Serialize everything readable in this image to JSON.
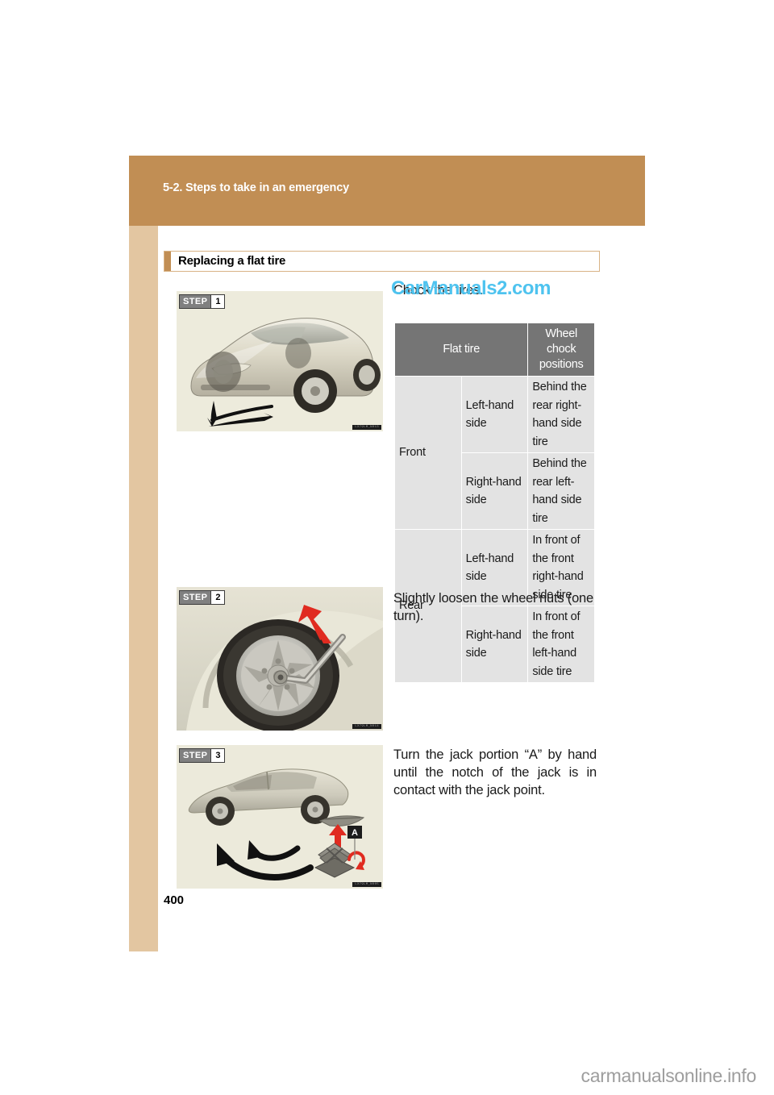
{
  "header": {
    "chapter_title": "5-2. Steps to take in an emergency"
  },
  "section": {
    "title": "Replacing a flat tire"
  },
  "watermarks": {
    "top": "CarManuals2.com",
    "bottom": "carmanualsonline.info"
  },
  "steps": [
    {
      "badge_label": "STEP",
      "badge_number": "1",
      "figure_credit": "LX79LM_N013",
      "instruction": "Chock the tires."
    },
    {
      "badge_label": "STEP",
      "badge_number": "2",
      "figure_credit": "LX79LM_N014",
      "instruction": "Slightly loosen the wheel nuts (one turn)."
    },
    {
      "badge_label": "STEP",
      "badge_number": "3",
      "figure_credit": "LX79LM_N005",
      "instruction": "Turn the jack portion “A” by hand until the notch of the jack is in contact with the jack point.",
      "callout_label": "A"
    }
  ],
  "chock_table": {
    "headers": {
      "flat_tire": "Flat tire",
      "wheel_chock_positions": "Wheel chock positions"
    },
    "rows": [
      {
        "axle": "Front",
        "side": "Left-hand side",
        "position": "Behind the rear right-hand side tire"
      },
      {
        "axle": "Front",
        "side": "Right-hand side",
        "position": "Behind the rear left-hand side tire"
      },
      {
        "axle": "Rear",
        "side": "Left-hand side",
        "position": "In front of the front right-hand side tire"
      },
      {
        "axle": "Rear",
        "side": "Right-hand side",
        "position": "In front of the front left-hand side tire"
      }
    ]
  },
  "footer": {
    "page_number": "400"
  },
  "colors": {
    "header_band": "#c18e54",
    "side_rail": "#e3c6a1",
    "table_header": "#757575",
    "table_cell": "#e3e3e3",
    "figure_bg": "#edebdc",
    "watermark_top": "#4ec3ef",
    "accent_arrow": "#e02b20"
  }
}
